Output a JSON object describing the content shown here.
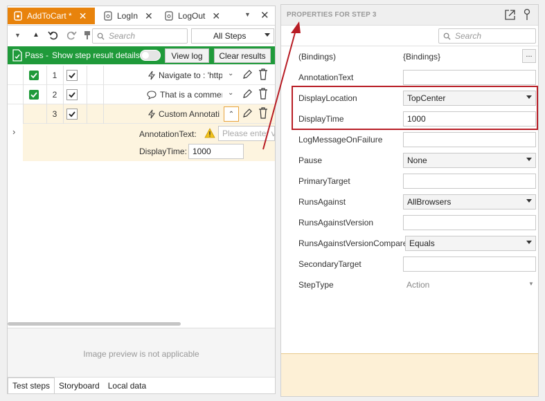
{
  "tabs": [
    {
      "label": "AddToCart *",
      "active": true
    },
    {
      "label": "LogIn",
      "active": false
    },
    {
      "label": "LogOut",
      "active": false
    }
  ],
  "toolbar": {
    "search_placeholder": "Search",
    "filter_value": "All Steps"
  },
  "result_bar": {
    "status": "Pass -",
    "show_details_label": "Show step result details",
    "view_log_label": "View log",
    "clear_results_label": "Clear results",
    "color": "#1f9a3a"
  },
  "steps": [
    {
      "num": "1",
      "description": "Navigate to : 'http"
    },
    {
      "num": "2",
      "description": "That is a commer"
    },
    {
      "num": "3",
      "description": "Custom Annotati"
    }
  ],
  "expanded_step": {
    "annotation_label": "AnnotationText:",
    "annotation_placeholder": "Please enter valu",
    "display_time_label": "DisplayTime:",
    "display_time_value": "1000"
  },
  "preview": {
    "text": "Image preview is not applicable"
  },
  "bottom_tabs": [
    "Test steps",
    "Storyboard",
    "Local data"
  ],
  "properties": {
    "title": "PROPERTIES FOR STEP 3",
    "search_placeholder": "Search",
    "bindings_button": "...",
    "rows": [
      {
        "label": "(Bindings)",
        "value": "{Bindings}",
        "kind": "text-plain"
      },
      {
        "label": "AnnotationText",
        "value": "",
        "kind": "input"
      },
      {
        "label": "DisplayLocation",
        "value": "TopCenter",
        "kind": "select"
      },
      {
        "label": "DisplayTime",
        "value": "1000",
        "kind": "input"
      },
      {
        "label": "LogMessageOnFailure",
        "value": "",
        "kind": "input"
      },
      {
        "label": "Pause",
        "value": "None",
        "kind": "select"
      },
      {
        "label": "PrimaryTarget",
        "value": "",
        "kind": "input"
      },
      {
        "label": "RunsAgainst",
        "value": "AllBrowsers",
        "kind": "select"
      },
      {
        "label": "RunsAgainstVersion",
        "value": "",
        "kind": "input"
      },
      {
        "label": "RunsAgainstVersionCompare",
        "value": "Equals",
        "kind": "select"
      },
      {
        "label": "SecondaryTarget",
        "value": "",
        "kind": "input"
      },
      {
        "label": "StepType",
        "value": "Action",
        "kind": "disabled-select"
      }
    ]
  },
  "colors": {
    "accent": "#e8830c",
    "highlight": "#b81c24",
    "selected_row": "#fdf4df"
  }
}
